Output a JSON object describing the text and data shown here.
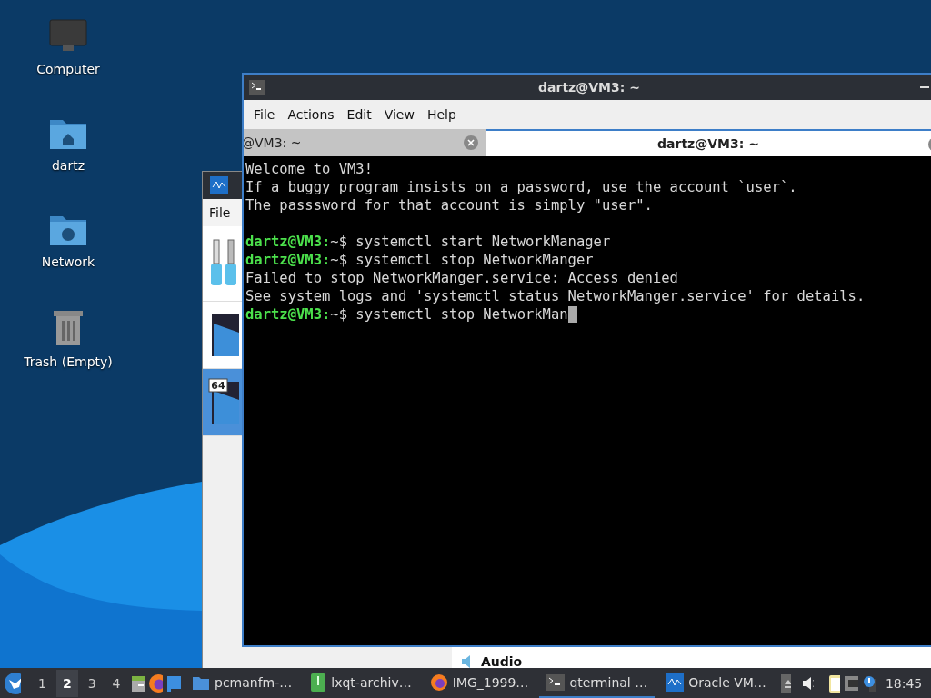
{
  "desktop_icons": [
    {
      "label": "Computer",
      "kind": "computer"
    },
    {
      "label": "dartz",
      "kind": "home"
    },
    {
      "label": "Network",
      "kind": "network"
    },
    {
      "label": "Trash (Empty)",
      "kind": "trash"
    }
  ],
  "background_window": {
    "menu": [
      "File"
    ],
    "items": [
      {
        "kind": "tools",
        "selected": false
      },
      {
        "kind": "machine",
        "selected": false
      },
      {
        "kind": "machine64",
        "badge": "64",
        "selected": true
      }
    ],
    "detail_heading": "Audio"
  },
  "terminal": {
    "title": "dartz@VM3: ~",
    "menu": [
      "File",
      "Actions",
      "Edit",
      "View",
      "Help"
    ],
    "tabs": [
      {
        "label": "@VM3: ~",
        "selected": false
      },
      {
        "label": "dartz@VM3: ~",
        "selected": true
      }
    ],
    "lines": [
      {
        "kind": "output",
        "text": "Welcome to VM3!"
      },
      {
        "kind": "output",
        "text": "If a buggy program insists on a password, use the account `user`."
      },
      {
        "kind": "output",
        "text": "The passsword for that account is simply \"user\"."
      },
      {
        "kind": "blank"
      },
      {
        "kind": "prompt",
        "prompt": "dartz@VM3:",
        "text": "~$ systemctl start NetworkManager"
      },
      {
        "kind": "prompt",
        "prompt": "dartz@VM3:",
        "text": "~$ systemctl stop NetworkManger"
      },
      {
        "kind": "output",
        "text": "Failed to stop NetworkManger.service: Access denied"
      },
      {
        "kind": "output",
        "text": "See system logs and 'systemctl status NetworkManger.service' for details."
      },
      {
        "kind": "prompt",
        "prompt": "dartz@VM3:",
        "text": "~$ systemctl stop NetworkMan",
        "cursor": true
      }
    ]
  },
  "taskbar": {
    "workspaces": [
      {
        "label": "1",
        "selected": false
      },
      {
        "label": "2",
        "selected": true
      },
      {
        "label": "3",
        "selected": false
      },
      {
        "label": "4",
        "selected": false
      }
    ],
    "tasks": [
      {
        "label": "pcmanfm-…",
        "kind": "folder",
        "selected": false
      },
      {
        "label": "lxqt-archiv…",
        "kind": "archive",
        "selected": false
      },
      {
        "label": "IMG_1999…",
        "kind": "firefox",
        "selected": false
      },
      {
        "label": "qterminal …",
        "kind": "terminal",
        "selected": true
      },
      {
        "label": "Oracle VM…",
        "kind": "vbox",
        "selected": false
      }
    ],
    "clock": "18:45"
  }
}
